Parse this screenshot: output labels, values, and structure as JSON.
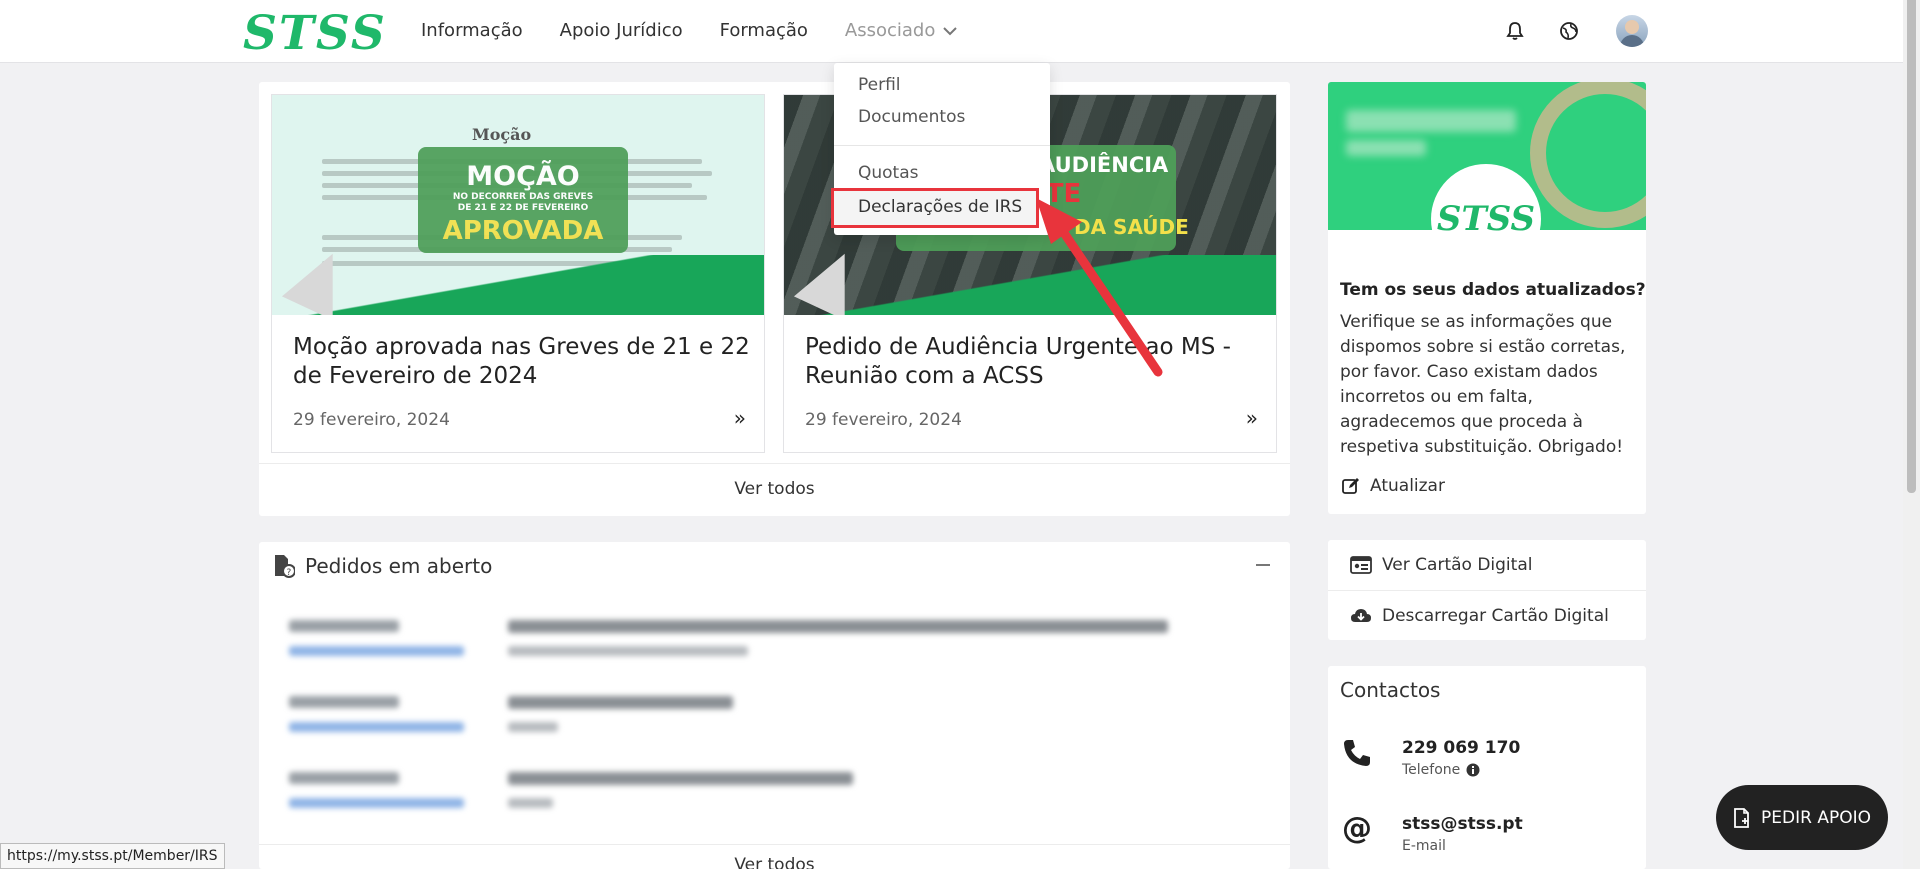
{
  "brand": {
    "logo_text": "STSS",
    "accent": "#1fb86a"
  },
  "nav": {
    "items": [
      "Informação",
      "Apoio Jurídico",
      "Formação"
    ],
    "associado": "Associado"
  },
  "dropdown": {
    "items": [
      "Perfil",
      "Documentos",
      "Quotas",
      "Declarações de IRS"
    ],
    "highlight_color": "#e8343c"
  },
  "news": {
    "cards": [
      {
        "title": "Moção aprovada nas Greves de 21 e 22 de Fevereiro de 2024",
        "date": "29 fevereiro, 2024",
        "image_badge": [
          "MOÇÃO",
          "NO DECORRER DAS GREVES",
          "DE 21 E 22 DE FEVEREIRO",
          "APROVADA"
        ],
        "image_heading": "Moção"
      },
      {
        "title": "Pedido de Audiência Urgente ao MS - Reunião com a ACSS",
        "date": "29 fevereiro, 2024",
        "image_badge": [
          "AUDIÊNCIA",
          "NTE",
          "DA SAÚDE"
        ]
      }
    ],
    "see_all": "Ver todos"
  },
  "pedidos": {
    "title": "Pedidos em aberto",
    "see_all": "Ver todos"
  },
  "profile": {
    "logo_text": "STSS",
    "question": "Tem os seus dados atualizados?",
    "text": "Verifique se as informações que dispomos sobre si estão corretas, por favor. Caso existam dados incorretos ou em falta, agradecemos que proceda à respetiva substituição. Obrigado!",
    "update_label": "Atualizar"
  },
  "cartao": {
    "view": "Ver Cartão Digital",
    "download": "Descarregar Cartão Digital"
  },
  "contactos": {
    "title": "Contactos",
    "phone": "229 069 170",
    "phone_label": "Telefone",
    "email": "stss@stss.pt",
    "email_label": "E-mail"
  },
  "fab": {
    "label": "PEDIR APOIO"
  },
  "status_url": "https://my.stss.pt/Member/IRS"
}
